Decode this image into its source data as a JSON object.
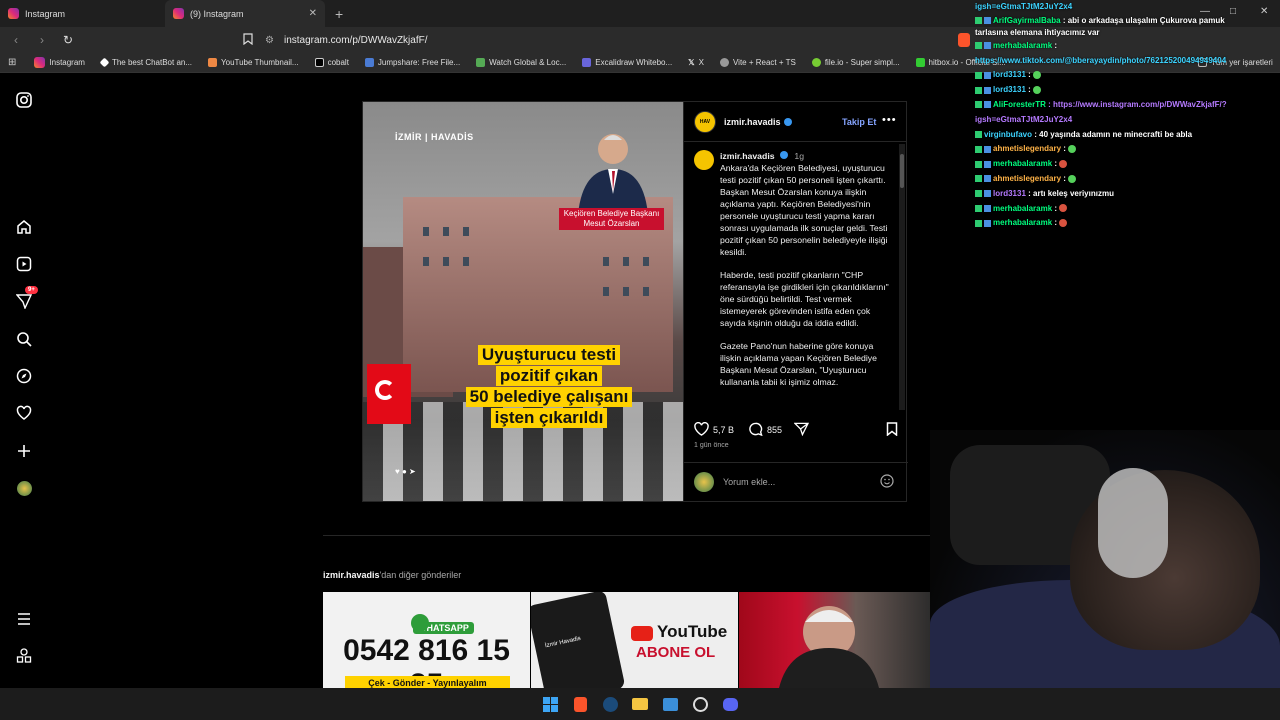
{
  "browser": {
    "tabs": [
      {
        "title": "Instagram"
      },
      {
        "title": "(9) Instagram"
      }
    ],
    "url": "instagram.com/p/DWWavZkjafF/",
    "bookmarks": [
      "Instagram",
      "The best ChatBot an...",
      "YouTube Thumbnail...",
      "cobalt",
      "Jumpshare: Free File...",
      "Watch Global & Loc...",
      "Excalidraw Whitebo...",
      "X",
      "Vite + React + TS",
      "file.io - Super simpl...",
      "hitbox.io - Official Si..."
    ],
    "other_bookmarks": "Tüm yer işaretleri"
  },
  "sidebar": {
    "notification_badge": "9+"
  },
  "post": {
    "username": "izmir.havadis",
    "follow_label": "Takip Et",
    "image": {
      "brand": "İZMİR | HAVADİS",
      "person_caption": "Keçiören Belediye Başkanı Mesut Özarslan",
      "headline": [
        "Uyuşturucu testi",
        "pozitif çıkan",
        "50 belediye çalışanı",
        "işten çıkarıldı"
      ]
    },
    "caption_user": "izmir.havadis",
    "caption_time": "1g",
    "caption_paragraphs": [
      "Ankara'da Keçiören Belediyesi, uyuşturucu testi pozitif çıkan 50 personeli işten çıkarttı. Başkan Mesut Özarslan konuya ilişkin açıklama yaptı. Keçiören Belediyesi'nin personele uyuşturucu testi yapma kararı sonrası uygulamada ilk sonuçlar geldi. Testi pozitif çıkan 50 personelin belediyeyle ilişiği kesildi.",
      "Haberde, testi pozitif çıkanların \"CHP referansıyla işe girdikleri için çıkarıldıklarını\" öne sürdüğü belirtildi. Test vermek istemeyerek görevinden istifa eden çok sayıda kişinin olduğu da iddia edildi.",
      "Gazete Pano'nun haberine göre konuya ilişkin açıklama yapan Keçiören Belediye Başkanı Mesut Özarslan, \"Uyuşturucu kullananla tabii ki işimiz olmaz."
    ],
    "likes": "5,7 B",
    "comments": "855",
    "time_ago": "1 gün önce",
    "comment_placeholder": "Yorum ekle..."
  },
  "more_posts": {
    "username": "izmir.havadis",
    "suffix": "'dan diğer gönderiler",
    "thumb1": {
      "label": "WHATSAPP",
      "number": "0542 816 15 35",
      "bar": "Çek - Gönder - Yayınlayalım"
    },
    "thumb2": {
      "title": "YouTube",
      "subtitle": "ABONE OL",
      "phone_label": "İzmir Havadis"
    }
  },
  "chat": [
    {
      "user": "",
      "text": "igsh=eGtmaTJtM2JuY2x4",
      "color": "c"
    },
    {
      "user": "ArifGayirmalBaba",
      "text": ": abi o arkadaşa ulaşalım Çukurova pamuk tarlasına elemana ihtiyacımız var",
      "color": "g"
    },
    {
      "user": "merhabalaramk",
      "text": ":",
      "color": "g"
    },
    {
      "user": "",
      "text": "https://www.tiktok.com/@bberayaydin/photo/762125200494949404",
      "color": "c"
    },
    {
      "user": "lord3131",
      "text": ":",
      "color": "c",
      "emoji": "green"
    },
    {
      "user": "lord3131",
      "text": ":",
      "color": "c",
      "emoji": "green"
    },
    {
      "user": "AliForesterTR",
      "text": ": https://www.instagram.com/p/DWWavZkjafF/?",
      "color": "g"
    },
    {
      "user": "",
      "text": "igsh=eGtmaTJtM2JuY2x4",
      "color": "c"
    },
    {
      "user": "virginbufavo",
      "text": ": 40 yaşında adamın ne minecrafti be abla",
      "color": "c"
    },
    {
      "user": "ahmetislegendary",
      "text": ":",
      "color": "o",
      "emoji": "green"
    },
    {
      "user": "merhabalaramk",
      "text": ":",
      "color": "g",
      "emoji": "red"
    },
    {
      "user": "ahmetislegendary",
      "text": ":",
      "color": "o",
      "emoji": "green"
    },
    {
      "user": "lord3131",
      "text": ": artı keleş veriyınızmu",
      "color": "p"
    },
    {
      "user": "merhabalaramk",
      "text": ":",
      "color": "g",
      "emoji": "red"
    },
    {
      "user": "merhabalaramk",
      "text": ":",
      "color": "g",
      "emoji": "red"
    }
  ],
  "colors": {
    "accent_link": "#85a4ff",
    "headline_bg": "#ffd200",
    "badge_red": "#ff3040"
  }
}
